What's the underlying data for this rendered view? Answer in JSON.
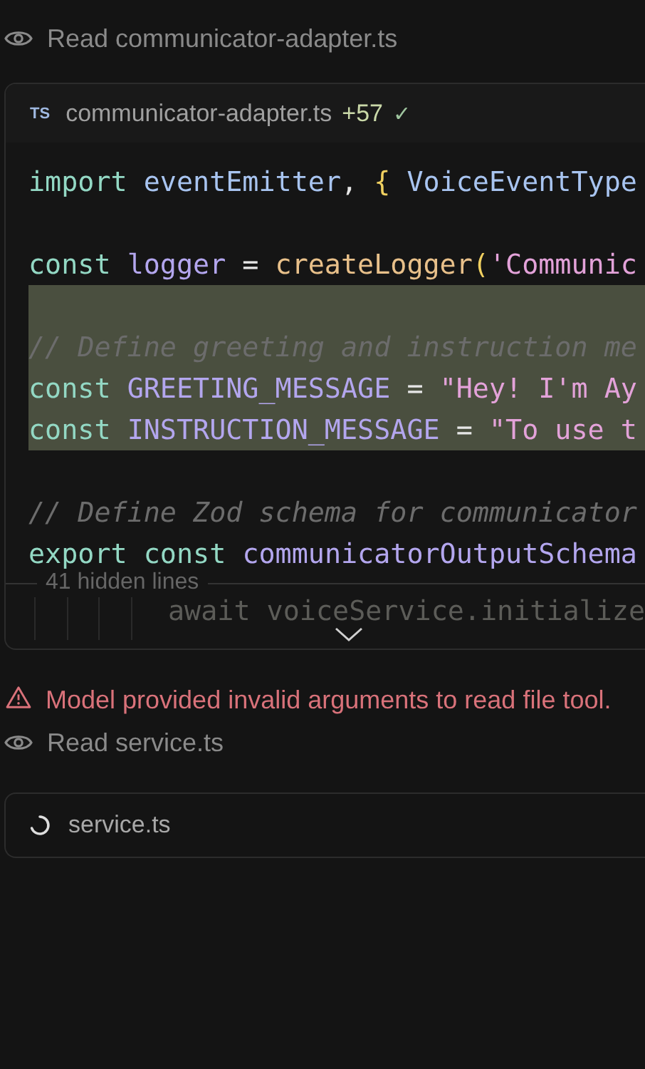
{
  "items": [
    {
      "kind": "read",
      "label": "Read communicator-adapter.ts"
    },
    {
      "kind": "file_card",
      "badge": "TS",
      "filename": "communicator-adapter.ts",
      "additions": "+57",
      "check": "✓",
      "lines": [
        {
          "highlighted": false,
          "tokens": [
            {
              "text": "import ",
              "kind": "kw"
            },
            {
              "text": "eventEmitter",
              "kind": "id"
            },
            {
              "text": ", "
            },
            {
              "text": "{ ",
              "kind": "brace"
            },
            {
              "text": "VoiceEventType",
              "kind": "id"
            }
          ]
        },
        {
          "highlighted": false
        },
        {
          "highlighted": false,
          "tokens": [
            {
              "text": "const ",
              "kind": "kw"
            },
            {
              "text": "logger",
              "kind": "const"
            },
            {
              "text": " = "
            },
            {
              "text": "createLogger",
              "kind": "fn"
            },
            {
              "text": "(",
              "kind": "brace"
            },
            {
              "text": "'Communic",
              "kind": "str"
            }
          ]
        },
        {
          "highlighted": true
        },
        {
          "highlighted": true,
          "tokens": [
            {
              "text": "// Define greeting and instruction me",
              "kind": "comment"
            }
          ]
        },
        {
          "highlighted": true,
          "tokens": [
            {
              "text": "const ",
              "kind": "kw"
            },
            {
              "text": "GREETING_MESSAGE",
              "kind": "const"
            },
            {
              "text": " = "
            },
            {
              "text": "\"Hey! I'm Ay",
              "kind": "str"
            }
          ]
        },
        {
          "highlighted": true,
          "tokens": [
            {
              "text": "const ",
              "kind": "kw"
            },
            {
              "text": "INSTRUCTION_MESSAGE",
              "kind": "const"
            },
            {
              "text": " = "
            },
            {
              "text": "\"To use t",
              "kind": "str"
            }
          ]
        },
        {
          "highlighted": false
        },
        {
          "highlighted": false,
          "tokens": [
            {
              "text": "// Define Zod schema for communicator",
              "kind": "comment"
            }
          ]
        },
        {
          "highlighted": false,
          "tokens": [
            {
              "text": "export ",
              "kind": "kw"
            },
            {
              "text": "const ",
              "kind": "kw"
            },
            {
              "text": "communicatorOutputSchema",
              "kind": "const"
            }
          ]
        }
      ],
      "hidden_lines": "41 hidden lines",
      "faded_line": "await voiceService.initialize"
    },
    {
      "kind": "error",
      "message": "Model provided invalid arguments to read file tool."
    },
    {
      "kind": "read",
      "label": "Read service.ts"
    },
    {
      "kind": "loading_card",
      "filename": "service.ts"
    }
  ]
}
